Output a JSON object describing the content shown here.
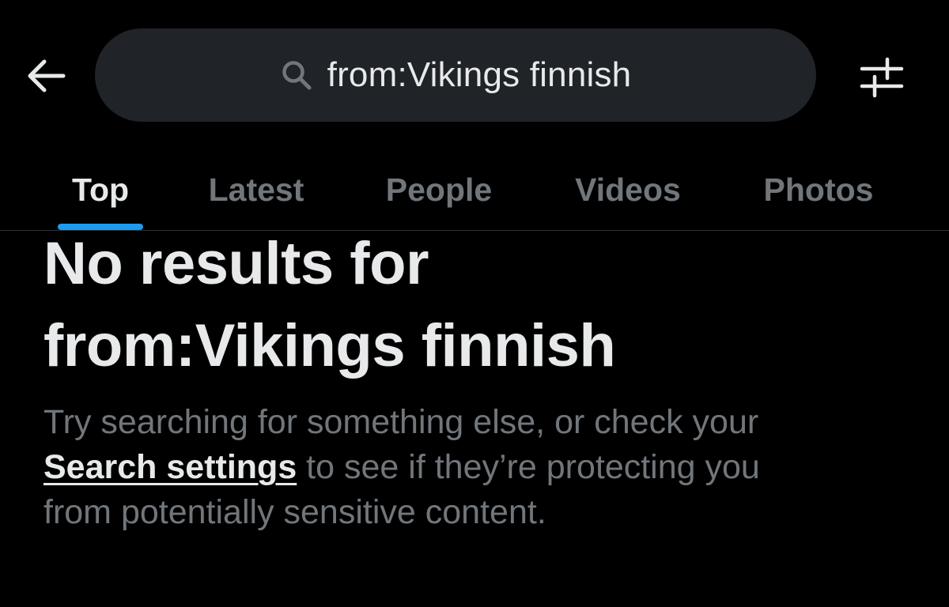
{
  "search": {
    "query": "from:Vikings finnish"
  },
  "icons": {
    "back": "back-arrow-icon",
    "search": "search-icon",
    "filter": "filter-sliders-icon"
  },
  "tabs": [
    {
      "label": "Top",
      "active": true
    },
    {
      "label": "Latest",
      "active": false
    },
    {
      "label": "People",
      "active": false
    },
    {
      "label": "Videos",
      "active": false
    },
    {
      "label": "Photos",
      "active": false
    }
  ],
  "empty_state": {
    "title_line1": "No results for",
    "title_line2": "from:Vikings finnish",
    "desc_line1": "Try searching for something else, or check your",
    "link_label": "Search settings",
    "desc_line2_rest": " to see if they’re protecting you",
    "desc_line3": "from potentially sensitive content."
  },
  "colors": {
    "background": "#000000",
    "primary_text": "#e7e9ea",
    "secondary_text": "#71767b",
    "accent": "#1d9bf0",
    "search_bg": "#202327"
  }
}
